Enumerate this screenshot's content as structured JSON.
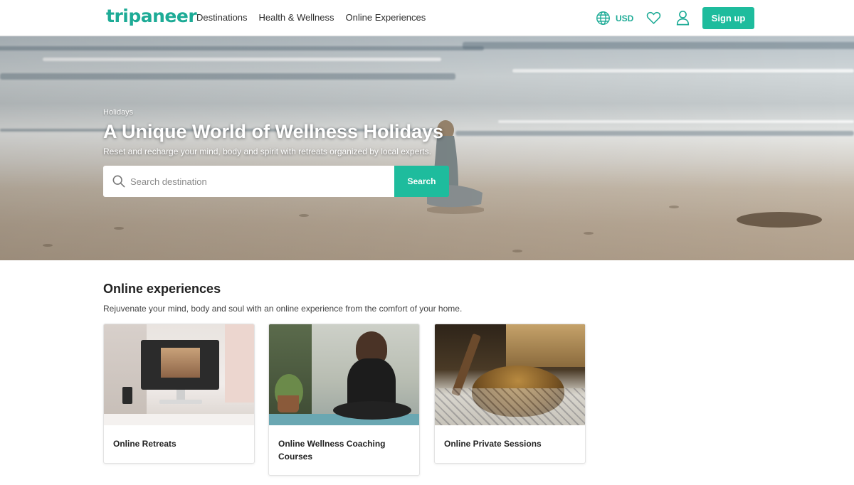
{
  "header": {
    "logo": "tripaneer",
    "nav": [
      "Destinations",
      "Health & Wellness",
      "Online Experiences"
    ],
    "currency": "USD",
    "signup_label": "Sign up",
    "brand_color": "#1ebc9d"
  },
  "hero": {
    "breadcrumb": "Holidays",
    "title": "A Unique World of Wellness Holidays",
    "subtitle": "Reset and recharge your mind, body and spirit with retreats organized by local experts.",
    "search": {
      "placeholder": "Search destination",
      "button_label": "Search"
    }
  },
  "online_experiences": {
    "title": "Online experiences",
    "subtitle": "Rejuvenate your mind, body and soul with an online experience from the comfort of your home.",
    "cards": [
      {
        "label": "Online Retreats"
      },
      {
        "label": "Online Wellness Coaching Courses"
      },
      {
        "label": "Online Private Sessions"
      }
    ]
  }
}
